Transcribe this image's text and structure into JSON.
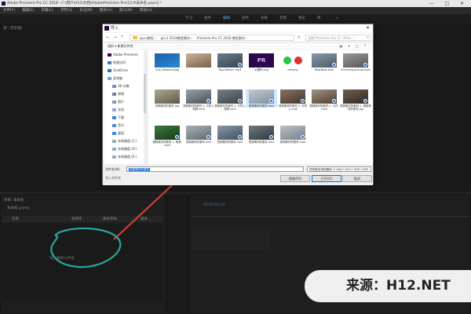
{
  "window": {
    "title": "Adobe Premiere Pro CC 2018 - C:\\用户\\H12\\文档\\Adobe\\Premiere Pro\\12.0\\未命名.prproj *",
    "controls": "— □ ✕"
  },
  "menubar": [
    "文件(F)",
    "编辑(E)",
    "剪辑(C)",
    "序列(S)",
    "标记(M)",
    "图形(G)",
    "窗口(W)",
    "帮助(H)"
  ],
  "workspaces": [
    {
      "label": "学习",
      "active": false
    },
    {
      "label": "组件",
      "active": false
    },
    {
      "label": "编辑",
      "active": true
    },
    {
      "label": "颜色",
      "active": false
    },
    {
      "label": "效果",
      "active": false
    },
    {
      "label": "音频",
      "active": false
    },
    {
      "label": "图形",
      "active": false
    },
    {
      "label": "库",
      "active": false
    },
    {
      "label": "»",
      "active": false
    }
  ],
  "panels": {
    "source_label": "源: (无剪辑)",
    "program_timecode": "00;00;00;00",
    "project_title": "项目: 未命名",
    "project_file": "未命名.prproj",
    "project_columns": [
      "名称",
      "帧速率",
      "媒体开始",
      "媒体"
    ],
    "project_empty_hint": "导入媒体以开始",
    "timeline_timecode": "00;00;00;00",
    "timeline_hint": "在此处放下媒体以创建序列。"
  },
  "dialog": {
    "title": "导入",
    "close": "✕",
    "path": [
      "gucu教程",
      "gcu1 2018教程素材",
      "Premiere Pro CC 2018 教程素材"
    ],
    "search_placeholder": "搜索\"Premiere Pro CC 2018...\"",
    "toolbar_left": "组织 ▾    新建文件夹",
    "toolbar_right": "▦ ▾ □ ?",
    "sidebar": [
      {
        "label": "Adobe Premiere",
        "color": "#2a0a4a"
      },
      {
        "label": "快速访问",
        "color": "#3a7bd5"
      },
      {
        "label": "OneDrive",
        "color": "#1e73c9"
      },
      {
        "label": "此电脑",
        "color": "#6aa7e0"
      },
      {
        "label": "3D 对象",
        "color": "#5f95d0"
      },
      {
        "label": "视频",
        "color": "#6a7fa8"
      },
      {
        "label": "图片",
        "color": "#7a9ac4"
      },
      {
        "label": "文档",
        "color": "#8fa9cf"
      },
      {
        "label": "下载",
        "color": "#3c83d6"
      },
      {
        "label": "音乐",
        "color": "#4c8be0"
      },
      {
        "label": "桌面",
        "color": "#3b88e0"
      },
      {
        "label": "本地磁盘 (C:)",
        "color": "#9ab"
      },
      {
        "label": "本地磁盘 (D:)",
        "color": "#9ab"
      },
      {
        "label": "本地磁盘 (E:)",
        "color": "#9ab"
      }
    ],
    "files": [
      {
        "name": "icon_diamond.jpg",
        "colors": [
          "#1a5fa8",
          "#2a8ad6"
        ],
        "badge": false
      },
      {
        "name": "",
        "colors": [
          "#c8b49a",
          "#7a6048"
        ],
        "badge": false
      },
      {
        "name": "Pag Station .mp4",
        "colors": [
          "#6b7c8a",
          "#334455"
        ],
        "badge": true
      },
      {
        "name": "pr图标.png",
        "colors": [
          "#2a0a4a",
          "#2a0a4a"
        ],
        "badge": false,
        "text": "PR"
      },
      {
        "name": "red.png",
        "colors": [
          "#ffffff",
          "#ffffff"
        ],
        "badge": false,
        "dots": true
      },
      {
        "name": "BoatBoat.mov",
        "colors": [
          "#8a9aa8",
          "#4a5a68"
        ],
        "badge": true
      },
      {
        "name": "Shrinking picture.mp4",
        "colors": [
          "#9a9a9a",
          "#555"
        ],
        "badge": true
      },
      {
        "name": "视频素材的素材.jpg",
        "colors": [
          "#b0a890",
          "#605848"
        ],
        "badge": false
      },
      {
        "name": "视频素材的素材-1. 可导入视频.mp4",
        "colors": [
          "#9aa0a6",
          "#4a5058"
        ],
        "badge": true
      },
      {
        "name": "视频素材的素材-1. 可导入视频.mp4",
        "colors": [
          "#7a8088",
          "#3a4048"
        ],
        "badge": true
      },
      {
        "name": "视频素材的素材.mov",
        "colors": [
          "#c0c8d0",
          "#8090a0"
        ],
        "badge": true,
        "selected": true
      },
      {
        "name": "视频素材的素材-1. 可导入.mp4",
        "colors": [
          "#887060",
          "#443830"
        ],
        "badge": true
      },
      {
        "name": "视频素材的素材-1. 文件.mp4",
        "colors": [
          "#a09080",
          "#504030"
        ],
        "badge": true
      },
      {
        "name": "视频素材的素材-1. 视频素材的素材.jpg",
        "colors": [
          "#706050",
          "#302820"
        ],
        "badge": true
      },
      {
        "name": "视频素材的素材-1. 视频.mp4",
        "colors": [
          "#3a7a3a",
          "#1a3a1a"
        ],
        "badge": true
      },
      {
        "name": "视频素材的素材.mov",
        "colors": [
          "#a8b0b8",
          "#606870"
        ],
        "badge": true
      },
      {
        "name": "视频素材的素材.mp4",
        "colors": [
          "#8898a8",
          "#405060"
        ],
        "badge": true
      },
      {
        "name": "视频素材的素材.mov",
        "colors": [
          "#707880",
          "#303840"
        ],
        "badge": true
      },
      {
        "name": "视频素材的素材.mp4",
        "colors": [
          "#b8c0c8",
          "#788088"
        ],
        "badge": true
      }
    ],
    "filename_label": "文件名(N):",
    "filename_value": "视频素材的素材",
    "filter_value": "所有受支持的媒体 (*.264;*.3G2;*.3GP;*.3GP",
    "open_label": "打开(O)",
    "cancel_label": "取消",
    "import_folder_label": "导入文件夹",
    "image_sequence_label": "图像序列"
  },
  "annotation_text": "导入媒体以开始",
  "watermark": "来源：H12.NET",
  "colors": {
    "accent": "#2aa6a0",
    "annotation": "#d23c3c"
  }
}
